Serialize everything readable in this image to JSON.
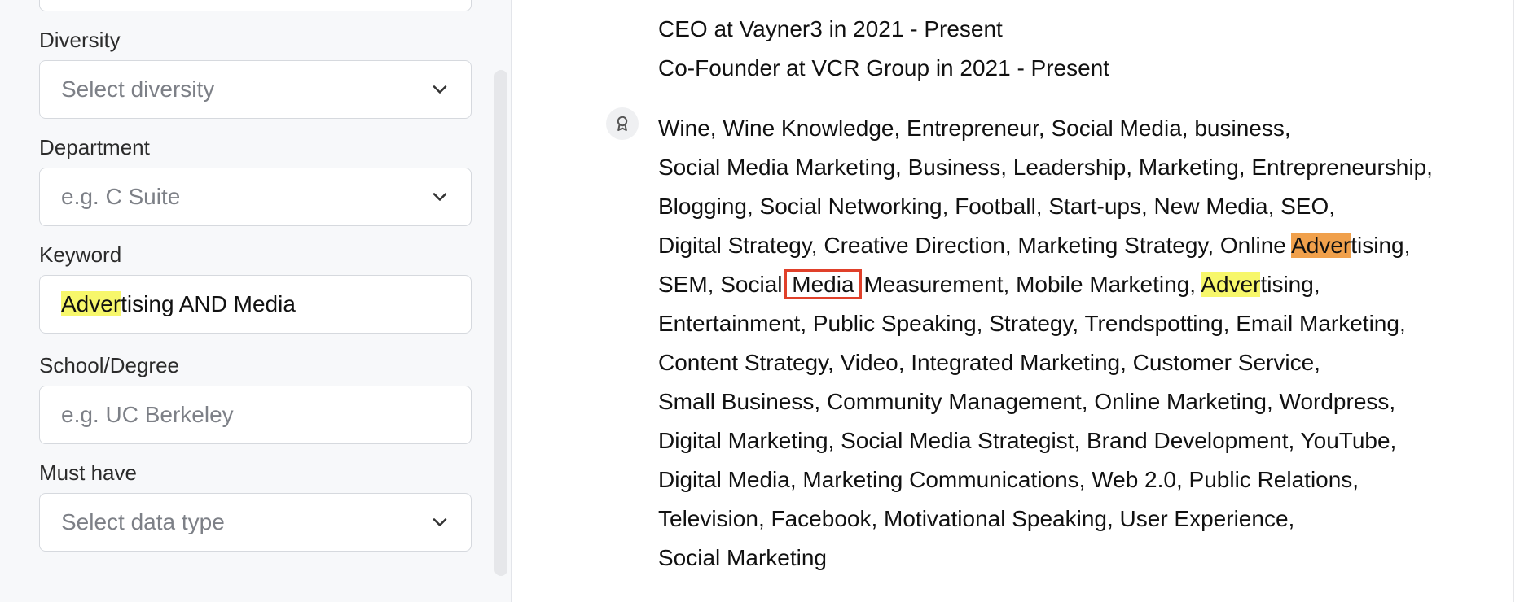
{
  "filters": {
    "diversity": {
      "label": "Diversity",
      "placeholder": "Select diversity"
    },
    "department": {
      "label": "Department",
      "placeholder": "e.g. C Suite"
    },
    "keyword": {
      "label": "Keyword",
      "value_highlight": "Adver",
      "value_rest": "tising AND Media"
    },
    "school": {
      "label": "School/Degree",
      "placeholder": "e.g. UC Berkeley"
    },
    "must_have": {
      "label": "Must have",
      "placeholder": "Select data type"
    }
  },
  "profile": {
    "positions": [
      "CEO at Vayner3 in 2021 - Present",
      "Co-Founder at VCR Group in 2021 - Present"
    ],
    "skills_icon": "award-icon",
    "skills": {
      "l1": "Wine, Wine Knowledge, Entrepreneur, Social Media, business,",
      "l2": "Social Media Marketing, Business, Leadership, Marketing, Entrepreneurship,",
      "l3": "Blogging, Social Networking, Football, Start-ups, New Media, SEO,",
      "l4_a": "Digital Strategy, Creative Direction, Marketing Strategy, Online ",
      "l4_hl": "Adver",
      "l4_b": "tising,",
      "l5_a": "SEM, Social ",
      "l5_box": "Media",
      "l5_b": " Measurement, Mobile Marketing, ",
      "l5_hl": "Adver",
      "l5_c": "tising,",
      "l6": "Entertainment, Public Speaking, Strategy, Trendspotting, Email Marketing,",
      "l7": "Content Strategy, Video, Integrated Marketing, Customer Service,",
      "l8": "Small Business, Community Management, Online Marketing, Wordpress,",
      "l9": "Digital Marketing, Social Media Strategist, Brand Development, YouTube,",
      "l10": "Digital Media, Marketing Communications, Web 2.0, Public Relations,",
      "l11": "Television, Facebook, Motivational Speaking, User Experience,",
      "l12": "Social Marketing"
    }
  },
  "colors": {
    "highlight_yellow": "#f7f76b",
    "highlight_orange": "#f0a04b",
    "box_outline": "#e0402a"
  }
}
